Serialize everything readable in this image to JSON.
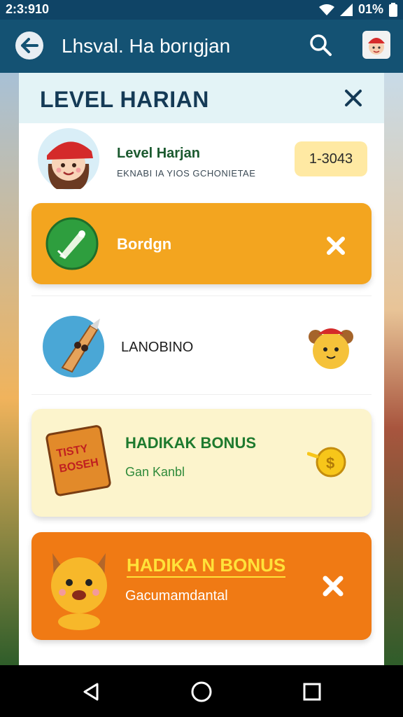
{
  "status_bar": {
    "time": "2:3:910",
    "battery": "01%"
  },
  "app_bar": {
    "title": "Lhsval. Ha borıgjan",
    "icons": {
      "back": "back-arrow-icon",
      "search": "search-icon",
      "avatar": "avatar"
    }
  },
  "panel": {
    "title": "LEVEL HARIAN",
    "close_icon": "close-icon",
    "profile": {
      "name": "Level Harjan",
      "subtitle": "EKNABI IA YIOS GCHONIETAE",
      "level_value": "1-3043"
    },
    "cards": [
      {
        "title": "Bordgn",
        "icon": "rocket-badge-icon",
        "action_icon": "close-icon"
      },
      {
        "title": "LANOBINO",
        "icon": "rocket-icon",
        "action_icon": "bear-icon"
      },
      {
        "title": "HADIKAK BONUS",
        "subtitle": "Gan Kanbl",
        "icon_text": [
          "TISTY",
          "BOSEH"
        ],
        "icon": "book-icon",
        "action_icon": "coin-icon"
      },
      {
        "title": "HADIKA N BONUS",
        "subtitle": "Gacumamdantal",
        "icon": "fox-icon",
        "action_icon": "close-icon"
      }
    ]
  },
  "colors": {
    "app_bar": "#145273",
    "card_orange": "#f3a51f",
    "card_cream": "#fcf4cc",
    "card_deep_orange": "#f07a14",
    "title_dark": "#143a56",
    "green_text": "#1b5a2f"
  }
}
